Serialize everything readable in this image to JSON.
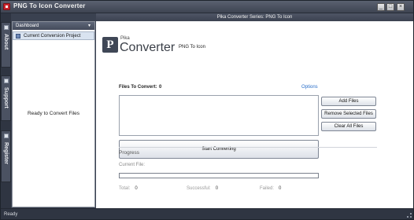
{
  "window": {
    "title": "PNG To Icon Converter",
    "minimize_label": "_",
    "maximize_label": "□",
    "close_label": "×"
  },
  "vtabs": {
    "about": "About",
    "support": "Support",
    "register": "Register"
  },
  "series_bar": "Pika Converter Series: PNG To Icon",
  "left_panel": {
    "dashboard": "Dashboard",
    "dashboard_arrow": "▾",
    "current_project": "Current Conversion Project",
    "ready_message": "Ready to Convert Files"
  },
  "brand": {
    "logo_letter": "P",
    "small": "Pika",
    "big": "Converter",
    "subtitle": "PNG To Icon"
  },
  "files": {
    "label": "Files To Convert:",
    "count": "0",
    "options_link": "Options"
  },
  "buttons": {
    "add_files": "Add Files",
    "remove_selected": "Remove Selected Files",
    "clear_all": "Clear All Files",
    "start": "Start Converting"
  },
  "progress": {
    "title": "Progress",
    "current_file_label": "Current File:",
    "fraction": 0,
    "total_label": "Total:",
    "total_value": "0",
    "successful_label": "Successful:",
    "successful_value": "0",
    "failed_label": "Failed:",
    "failed_value": "0"
  },
  "status_bar": {
    "text": "Ready"
  }
}
